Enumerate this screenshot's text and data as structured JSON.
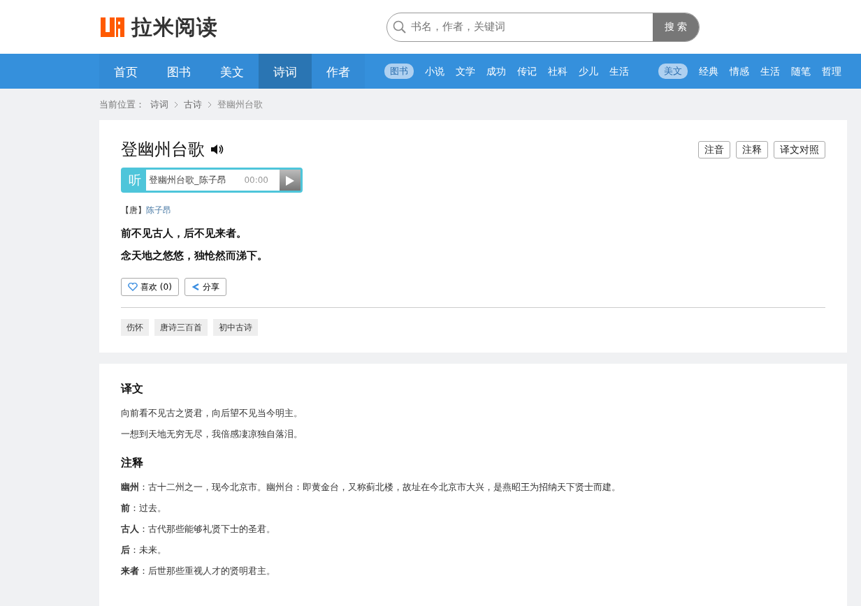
{
  "logo": {
    "text": "拉米阅读"
  },
  "search": {
    "placeholder": "书名，作者，关键词",
    "button": "搜 索"
  },
  "nav": [
    {
      "label": "首页",
      "selected": false
    },
    {
      "label": "图书",
      "selected": false
    },
    {
      "label": "美文",
      "selected": false
    },
    {
      "label": "诗词",
      "selected": true
    },
    {
      "label": "作者",
      "selected": false
    }
  ],
  "categories": [
    {
      "tag": "图书",
      "items": [
        "小说",
        "文学",
        "成功",
        "传记",
        "社科",
        "少儿",
        "生活"
      ]
    },
    {
      "tag": "美文",
      "items": [
        "经典",
        "情感",
        "生活",
        "随笔",
        "哲理"
      ]
    }
  ],
  "breadcrumb": {
    "prefix": "当前位置：",
    "items": [
      "诗词",
      "古诗",
      "登幽州台歌"
    ]
  },
  "poem": {
    "title": "登幽州台歌",
    "tools": [
      "注音",
      "注释",
      "译文对照"
    ],
    "audio": {
      "label": "听",
      "track": "登幽州台歌_陈子昂",
      "time": "00:00"
    },
    "dynasty": "【唐】",
    "author": "陈子昂",
    "lines": [
      "前不见古人，后不见来者。",
      "念天地之悠悠，独怆然而涕下。"
    ],
    "like": "喜欢 (0)",
    "share": "分享",
    "tags": [
      "伤怀",
      "唐诗三百首",
      "初中古诗"
    ]
  },
  "sections": [
    {
      "heading": "译文",
      "paragraphs": [
        "向前看不见古之贤君，向后望不见当今明主。",
        "一想到天地无穷无尽，我倍感凄凉独自落泪。"
      ]
    },
    {
      "heading": "注释",
      "paragraphs": [
        "**幽州**：古十二州之一，现今北京市。幽州台：即黄金台，又称蓟北楼，故址在今北京市大兴，是燕昭王为招纳天下贤士而建。",
        "**前**：过去。",
        "**古人**：古代那些能够礼贤下士的圣君。",
        "**后**：未来。",
        "**来者**：后世那些重视人才的贤明君主。"
      ]
    }
  ]
}
